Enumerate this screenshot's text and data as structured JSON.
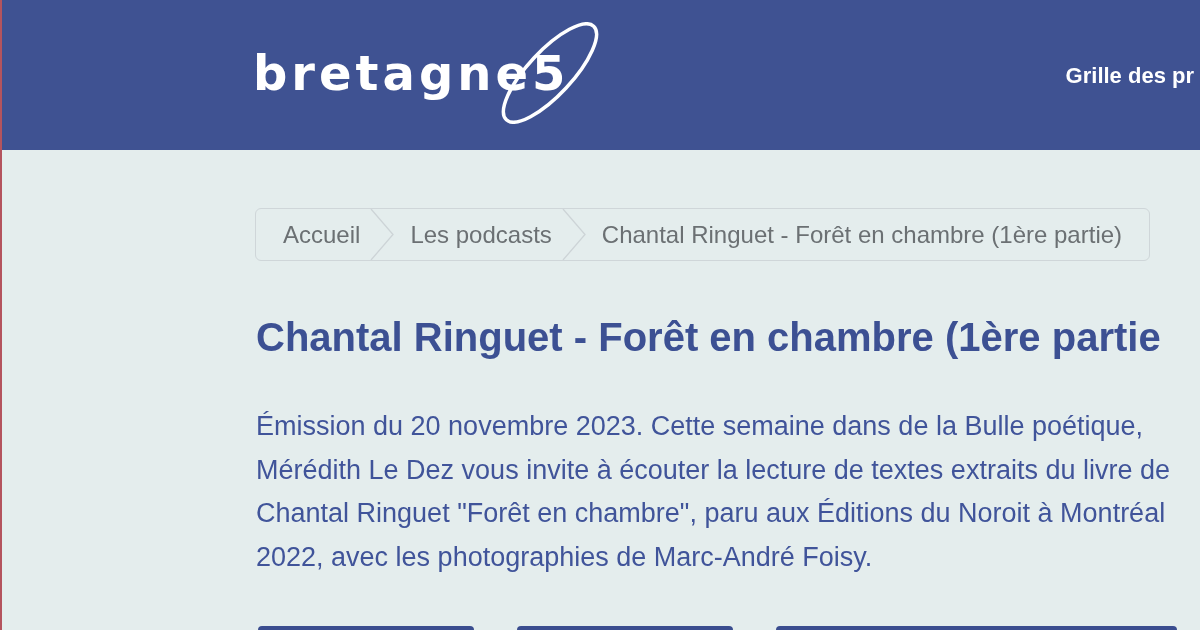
{
  "header": {
    "logo": "bretagne5",
    "nav": [
      {
        "label": "Grille des pr"
      }
    ]
  },
  "breadcrumb": [
    {
      "label": "Accueil"
    },
    {
      "label": "Les podcasts"
    },
    {
      "label": "Chantal Ringuet - Forêt en chambre (1ère partie)"
    }
  ],
  "title": "Chantal Ringuet - Forêt en chambre (1ère partie",
  "description": [
    "Émission du 20 novembre 2023. Cette semaine dans de la Bulle poétique,",
    "Mérédith Le Dez vous invite à écouter la lecture de textes extraits du livre de",
    "Chantal Ringuet \"Forêt en chambre\", paru aux Éditions du Noroit à Montréal",
    "2022, avec les photographies de Marc-André Foisy."
  ],
  "buttons": [
    {
      "kind": "button"
    },
    {
      "kind": "button"
    },
    {
      "kind": "wide"
    }
  ]
}
